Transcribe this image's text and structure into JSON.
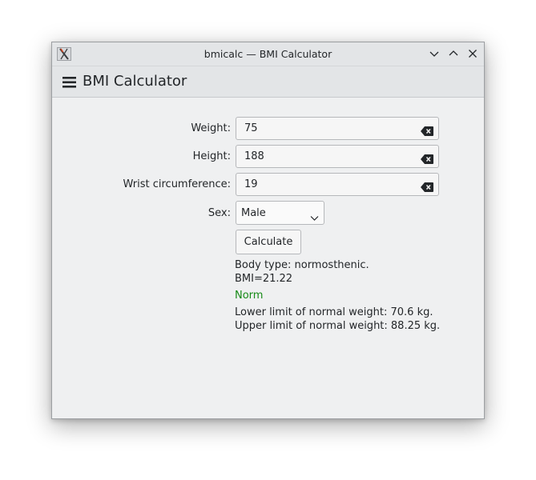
{
  "window": {
    "title": "bmicalc — BMI Calculator",
    "controls": [
      "minimize-icon",
      "maximize-icon",
      "close-icon"
    ]
  },
  "toolbar": {
    "menu_icon": "hamburger-menu-icon",
    "title": "BMI Calculator"
  },
  "form": {
    "weight": {
      "label": "Weight:",
      "value": "75"
    },
    "height": {
      "label": "Height:",
      "value": "188"
    },
    "wrist": {
      "label": "Wrist circumference:",
      "value": "19"
    },
    "sex": {
      "label": "Sex:",
      "value": "Male"
    },
    "calculate_label": "Calculate"
  },
  "results": {
    "body_type": "Body type: normosthenic.",
    "bmi": "BMI=21.22",
    "status": "Norm",
    "lower_limit": "Lower limit of normal weight: 70.6 kg.",
    "upper_limit": "Upper limit of normal weight: 88.25 kg."
  },
  "colors": {
    "status_norm": "#168a16",
    "window_bg": "#eff0f1",
    "titlebar_bg": "#e3e5e7"
  }
}
